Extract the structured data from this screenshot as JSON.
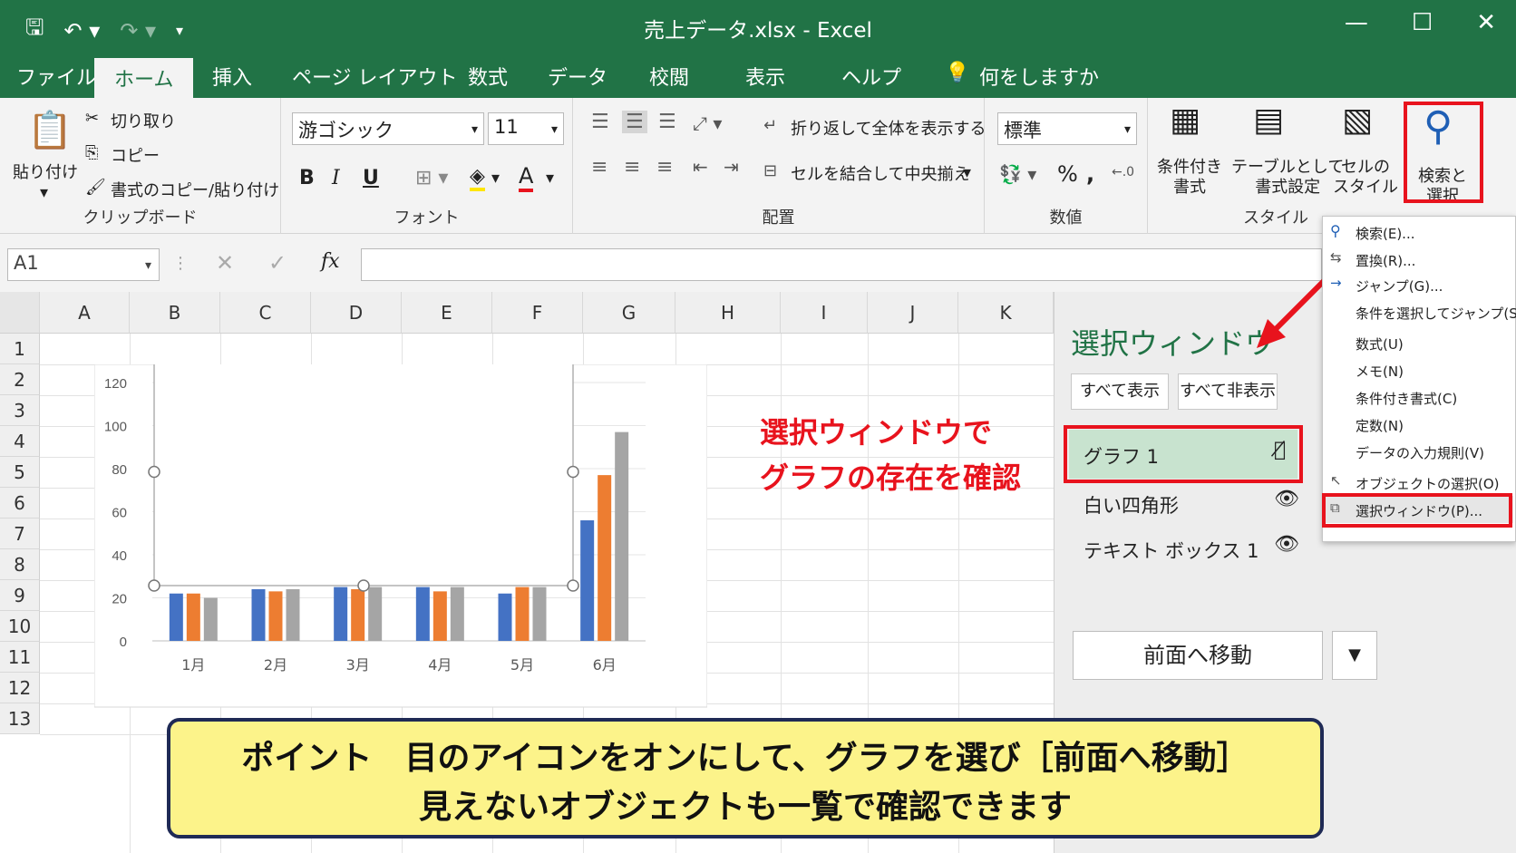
{
  "window": {
    "title": "売上データ.xlsx  -  Excel"
  },
  "tabs": [
    "ファイル",
    "ホーム",
    "挿入",
    "ページ レイアウト",
    "数式",
    "データ",
    "校閲",
    "表示",
    "ヘルプ"
  ],
  "tell_me": "何をしますか",
  "clipboard": {
    "paste": "貼り付け",
    "cut": "切り取り",
    "copy": "コピー",
    "format_painter": "書式のコピー/貼り付け",
    "label": "クリップボード"
  },
  "font": {
    "name": "游ゴシック",
    "size": "11",
    "bold": "B",
    "italic": "I",
    "underline": "U",
    "color_letter": "A",
    "label": "フォント"
  },
  "alignment": {
    "wrap": "折り返して全体を表示する",
    "merge": "セルを結合して中央揃え",
    "label": "配置"
  },
  "number": {
    "format": "標準",
    "percent": "%",
    "comma": ",",
    "label": "数値"
  },
  "styles": {
    "conditional": "条件付き\n書式",
    "table": "テーブルとして\n書式設定",
    "cell": "セルの\nスタイル",
    "label": "スタイル"
  },
  "find_select": {
    "label": "検索と\n選択"
  },
  "formula_bar": {
    "name_box": "A1",
    "fx": "fx"
  },
  "columns": [
    "A",
    "B",
    "C",
    "D",
    "E",
    "F",
    "G",
    "H",
    "I",
    "J",
    "K"
  ],
  "rows": [
    "1",
    "2",
    "3",
    "4",
    "5",
    "6",
    "7",
    "8",
    "9",
    "10",
    "11",
    "12",
    "13"
  ],
  "chart_data": {
    "type": "bar",
    "categories": [
      "1月",
      "2月",
      "3月",
      "4月",
      "5月",
      "6月"
    ],
    "series": [
      {
        "values": [
          22,
          24,
          25,
          25,
          22,
          56
        ]
      },
      {
        "values": [
          22,
          23,
          24,
          23,
          25,
          77
        ]
      },
      {
        "values": [
          20,
          24,
          25,
          25,
          25,
          97
        ]
      }
    ],
    "ylim": [
      0,
      120
    ],
    "yticks": [
      "0",
      "20",
      "40",
      "60",
      "80",
      "100",
      "120"
    ],
    "colors": [
      "#4472c4",
      "#ed7d31",
      "#a5a5a5"
    ]
  },
  "selection_pane": {
    "title": "選択ウィンドウ",
    "show_all": "すべて表示",
    "hide_all": "すべて非表示",
    "items": [
      "グラフ 1",
      "白い四角形",
      "テキスト ボックス 1"
    ],
    "bring_forward": "前面へ移動"
  },
  "find_menu": {
    "items": [
      "検索(E)...",
      "置換(R)...",
      "ジャンプ(G)...",
      "条件を選択してジャンプ(S)...",
      "数式(U)",
      "メモ(N)",
      "条件付き書式(C)",
      "定数(N)",
      "データの入力規則(V)",
      "オブジェクトの選択(O)",
      "選択ウィンドウ(P)..."
    ]
  },
  "annotation": {
    "line1": "選択ウィンドウで",
    "line2": "グラフの存在を確認"
  },
  "callout": {
    "line1": "ポイント　目のアイコンをオンにして、グラフを選び［前面へ移動］",
    "line2": "見えないオブジェクトも一覧で確認できます"
  }
}
